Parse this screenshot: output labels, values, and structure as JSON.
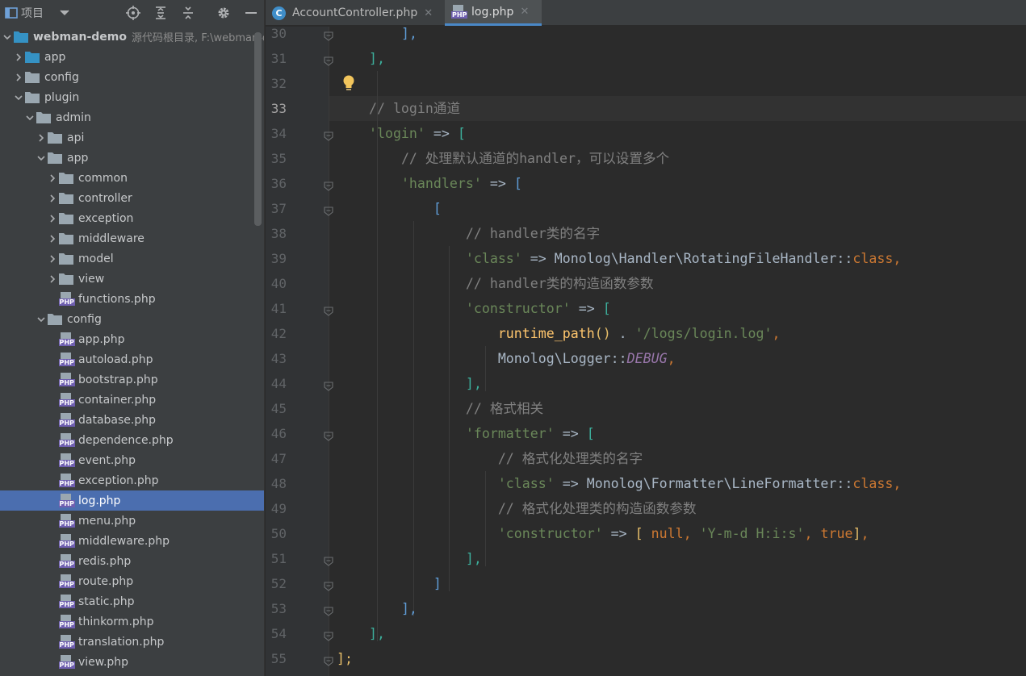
{
  "panel": {
    "title": "项目",
    "icons": [
      "locate-icon",
      "expand-all-icon",
      "collapse-all-icon",
      "settings-icon",
      "hide-icon"
    ]
  },
  "tree": {
    "root": {
      "name": "webman-demo",
      "note": "源代码根目录, F:\\webman-d"
    },
    "items": [
      {
        "label": "app",
        "depth": 1,
        "type": "folder",
        "open": false,
        "blue": true
      },
      {
        "label": "config",
        "depth": 1,
        "type": "folder",
        "open": false
      },
      {
        "label": "plugin",
        "depth": 1,
        "type": "folder",
        "open": true
      },
      {
        "label": "admin",
        "depth": 2,
        "type": "folder",
        "open": true
      },
      {
        "label": "api",
        "depth": 3,
        "type": "folder",
        "open": false
      },
      {
        "label": "app",
        "depth": 3,
        "type": "folder",
        "open": true
      },
      {
        "label": "common",
        "depth": 4,
        "type": "folder",
        "open": false
      },
      {
        "label": "controller",
        "depth": 4,
        "type": "folder",
        "open": false
      },
      {
        "label": "exception",
        "depth": 4,
        "type": "folder",
        "open": false
      },
      {
        "label": "middleware",
        "depth": 4,
        "type": "folder",
        "open": false
      },
      {
        "label": "model",
        "depth": 4,
        "type": "folder",
        "open": false
      },
      {
        "label": "view",
        "depth": 4,
        "type": "folder",
        "open": false
      },
      {
        "label": "functions.php",
        "depth": 4,
        "type": "php"
      },
      {
        "label": "config",
        "depth": 3,
        "type": "folder",
        "open": true
      },
      {
        "label": "app.php",
        "depth": 4,
        "type": "php"
      },
      {
        "label": "autoload.php",
        "depth": 4,
        "type": "php"
      },
      {
        "label": "bootstrap.php",
        "depth": 4,
        "type": "php"
      },
      {
        "label": "container.php",
        "depth": 4,
        "type": "php"
      },
      {
        "label": "database.php",
        "depth": 4,
        "type": "php"
      },
      {
        "label": "dependence.php",
        "depth": 4,
        "type": "php"
      },
      {
        "label": "event.php",
        "depth": 4,
        "type": "php"
      },
      {
        "label": "exception.php",
        "depth": 4,
        "type": "php"
      },
      {
        "label": "log.php",
        "depth": 4,
        "type": "php",
        "selected": true
      },
      {
        "label": "menu.php",
        "depth": 4,
        "type": "php"
      },
      {
        "label": "middleware.php",
        "depth": 4,
        "type": "php"
      },
      {
        "label": "redis.php",
        "depth": 4,
        "type": "php"
      },
      {
        "label": "route.php",
        "depth": 4,
        "type": "php"
      },
      {
        "label": "static.php",
        "depth": 4,
        "type": "php"
      },
      {
        "label": "thinkorm.php",
        "depth": 4,
        "type": "php"
      },
      {
        "label": "translation.php",
        "depth": 4,
        "type": "php"
      },
      {
        "label": "view.php",
        "depth": 4,
        "type": "php"
      }
    ]
  },
  "tabs": [
    {
      "label": "AccountController.php",
      "icon": "class-c-icon",
      "active": false
    },
    {
      "label": "log.php",
      "icon": "php-file-icon",
      "active": true
    }
  ],
  "tab_close_glyph": "✕",
  "editor": {
    "current_line": 33,
    "lightbulb_line": 32,
    "colors": {
      "string": "#6a8759",
      "comment": "#808080",
      "keyword": "#cc7832",
      "function": "#ffc66d",
      "constant": "#9876aa",
      "plain": "#a9b7c6"
    },
    "lines": [
      {
        "n": 30,
        "fold": true,
        "indent": 4,
        "tokens": [
          [
            "],",
            "br-b"
          ]
        ]
      },
      {
        "n": 31,
        "fold": true,
        "indent": 2,
        "tokens": [
          [
            "],",
            "br-g"
          ]
        ]
      },
      {
        "n": 32,
        "fold": false,
        "indent": 0,
        "tokens": []
      },
      {
        "n": 33,
        "fold": false,
        "indent": 2,
        "tokens": [
          [
            "// login通道",
            "cmt"
          ]
        ]
      },
      {
        "n": 34,
        "fold": true,
        "indent": 2,
        "tokens": [
          [
            "'login'",
            "str"
          ],
          [
            " => ",
            "op"
          ],
          [
            "[",
            "br-g"
          ]
        ]
      },
      {
        "n": 35,
        "fold": false,
        "indent": 4,
        "tokens": [
          [
            "// 处理默认通道的handler，可以设置多个",
            "cmt"
          ]
        ]
      },
      {
        "n": 36,
        "fold": true,
        "indent": 4,
        "tokens": [
          [
            "'handlers'",
            "str"
          ],
          [
            " => ",
            "op"
          ],
          [
            "[",
            "br-b"
          ]
        ]
      },
      {
        "n": 37,
        "fold": true,
        "indent": 6,
        "tokens": [
          [
            "[",
            "br-b"
          ]
        ]
      },
      {
        "n": 38,
        "fold": false,
        "indent": 8,
        "tokens": [
          [
            "// handler类的名字",
            "cmt"
          ]
        ]
      },
      {
        "n": 39,
        "fold": false,
        "indent": 8,
        "tokens": [
          [
            "'class'",
            "str"
          ],
          [
            " => Monolog\\Handler\\RotatingFileHandler::",
            "op"
          ],
          [
            "class",
            "kw"
          ],
          [
            ",",
            "kw"
          ]
        ]
      },
      {
        "n": 40,
        "fold": false,
        "indent": 8,
        "tokens": [
          [
            "// handler类的构造函数参数",
            "cmt"
          ]
        ]
      },
      {
        "n": 41,
        "fold": true,
        "indent": 8,
        "tokens": [
          [
            "'constructor'",
            "str"
          ],
          [
            " => ",
            "op"
          ],
          [
            "[",
            "br-g"
          ]
        ]
      },
      {
        "n": 42,
        "fold": false,
        "indent": 10,
        "tokens": [
          [
            "runtime_path",
            "fn"
          ],
          [
            "()",
            "br-y"
          ],
          [
            " . ",
            "op"
          ],
          [
            "'/logs/login.log'",
            "str"
          ],
          [
            ",",
            "kw"
          ]
        ]
      },
      {
        "n": 43,
        "fold": false,
        "indent": 10,
        "tokens": [
          [
            "Monolog\\Logger::",
            "op"
          ],
          [
            "DEBUG",
            "const"
          ],
          [
            ",",
            "kw"
          ]
        ]
      },
      {
        "n": 44,
        "fold": true,
        "indent": 8,
        "tokens": [
          [
            "],",
            "br-g"
          ]
        ]
      },
      {
        "n": 45,
        "fold": false,
        "indent": 8,
        "tokens": [
          [
            "// 格式相关",
            "cmt"
          ]
        ]
      },
      {
        "n": 46,
        "fold": true,
        "indent": 8,
        "tokens": [
          [
            "'formatter'",
            "str"
          ],
          [
            " => ",
            "op"
          ],
          [
            "[",
            "br-g"
          ]
        ]
      },
      {
        "n": 47,
        "fold": false,
        "indent": 10,
        "tokens": [
          [
            "// 格式化处理类的名字",
            "cmt"
          ]
        ]
      },
      {
        "n": 48,
        "fold": false,
        "indent": 10,
        "tokens": [
          [
            "'class'",
            "str"
          ],
          [
            " => Monolog\\Formatter\\LineFormatter::",
            "op"
          ],
          [
            "class",
            "kw"
          ],
          [
            ",",
            "kw"
          ]
        ]
      },
      {
        "n": 49,
        "fold": false,
        "indent": 10,
        "tokens": [
          [
            "// 格式化处理类的构造函数参数",
            "cmt"
          ]
        ]
      },
      {
        "n": 50,
        "fold": false,
        "indent": 10,
        "tokens": [
          [
            "'constructor'",
            "str"
          ],
          [
            " => ",
            "op"
          ],
          [
            "[",
            "br-y"
          ],
          [
            " ",
            "op"
          ],
          [
            "null",
            "kw"
          ],
          [
            ", ",
            "kw"
          ],
          [
            "'Y-m-d H:i:s'",
            "str"
          ],
          [
            ", ",
            "kw"
          ],
          [
            "true",
            "kw"
          ],
          [
            "]",
            "br-y"
          ],
          [
            ",",
            "kw"
          ]
        ]
      },
      {
        "n": 51,
        "fold": true,
        "indent": 8,
        "tokens": [
          [
            "],",
            "br-g"
          ]
        ]
      },
      {
        "n": 52,
        "fold": true,
        "indent": 6,
        "tokens": [
          [
            "]",
            "br-b"
          ]
        ]
      },
      {
        "n": 53,
        "fold": true,
        "indent": 4,
        "tokens": [
          [
            "],",
            "br-b"
          ]
        ]
      },
      {
        "n": 54,
        "fold": true,
        "indent": 2,
        "tokens": [
          [
            "],",
            "br-g"
          ]
        ]
      },
      {
        "n": 55,
        "fold": true,
        "indent": 0,
        "tokens": [
          [
            "];",
            "br-y"
          ]
        ]
      }
    ]
  }
}
